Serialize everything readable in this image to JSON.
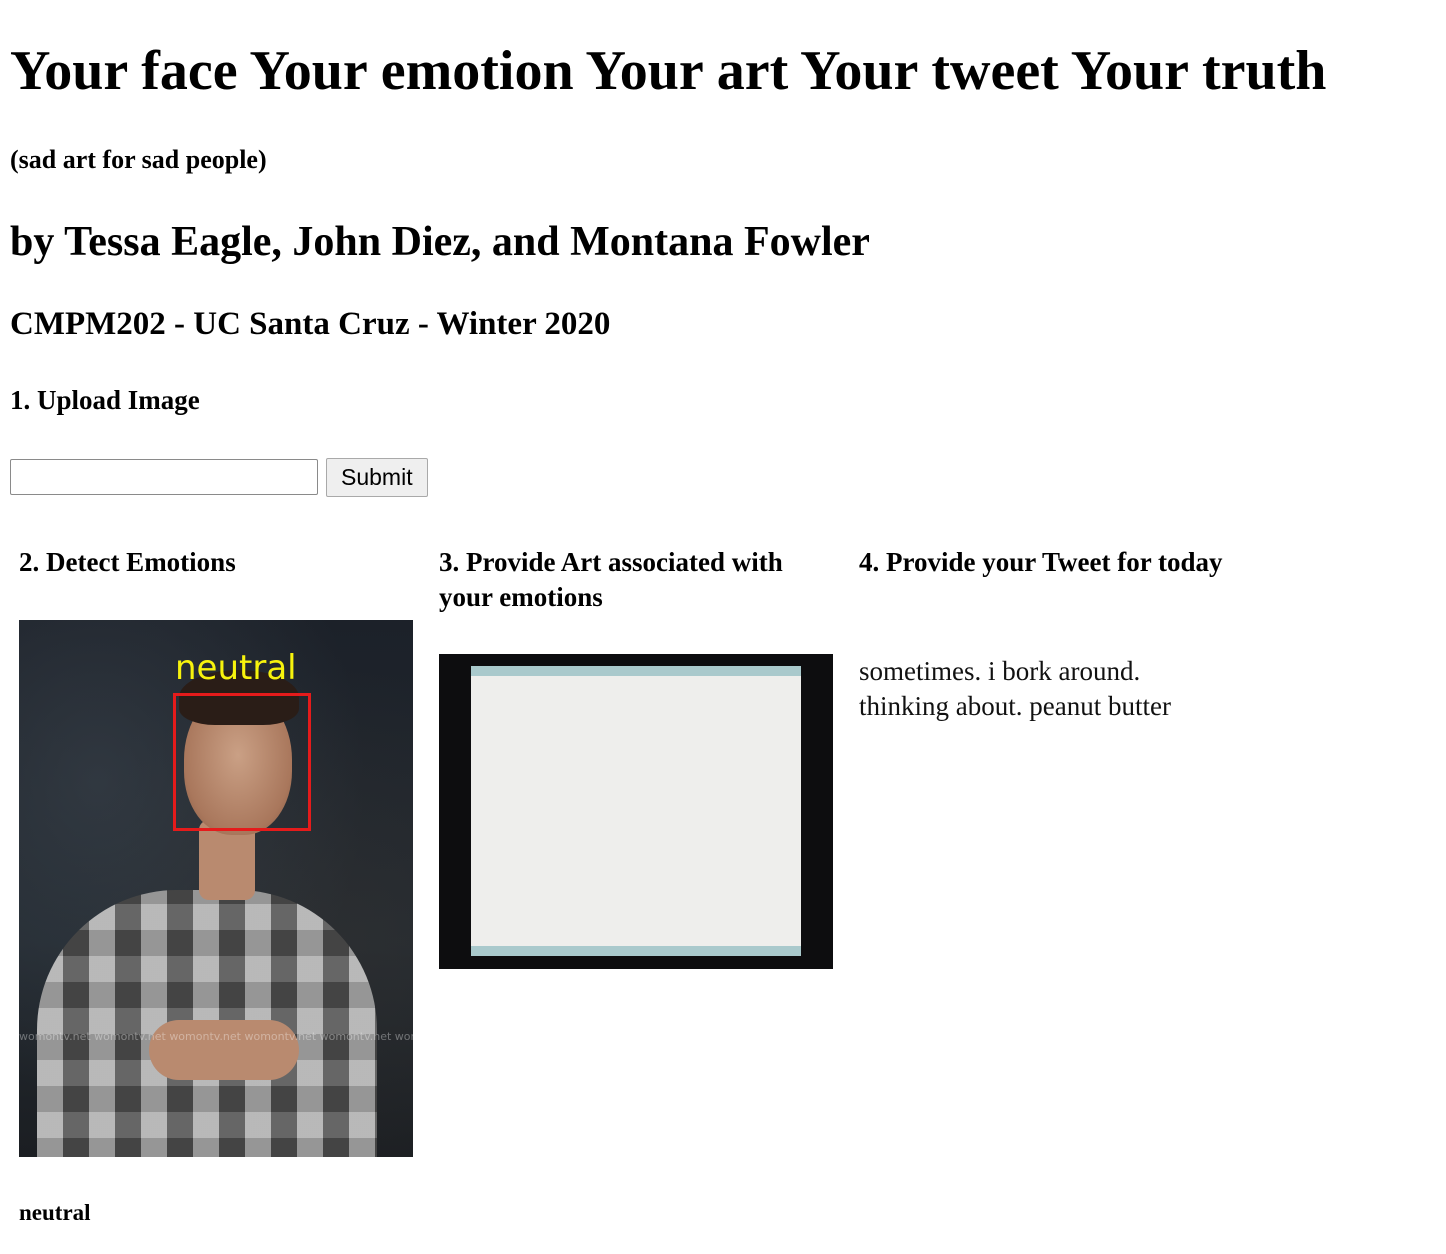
{
  "header": {
    "title": "Your face Your emotion Your art Your tweet Your truth",
    "subtitle": "(sad art for sad people)",
    "authors": "by Tessa Eagle, John Diez, and Montana Fowler",
    "course": "CMPM202 - UC Santa Cruz - Winter 2020"
  },
  "upload": {
    "heading": "1. Upload Image",
    "input_value": "",
    "submit_label": "Submit"
  },
  "detect": {
    "heading": "2. Detect Emotions",
    "face_label": "neutral",
    "watermark": "womontv.net womontv.net womontv.net womontv.net womontv.net womontv.net womontv.net womontv.net",
    "emotion": "neutral"
  },
  "art": {
    "heading": "3. Provide Art associated with your emotions"
  },
  "tweet": {
    "heading": "4. Provide your Tweet for today",
    "line1": "sometimes. i bork around.",
    "line2": "thinking about. peanut butter"
  },
  "colors": {
    "face_box": "#e51b1b",
    "face_label": "#f7f30d"
  }
}
